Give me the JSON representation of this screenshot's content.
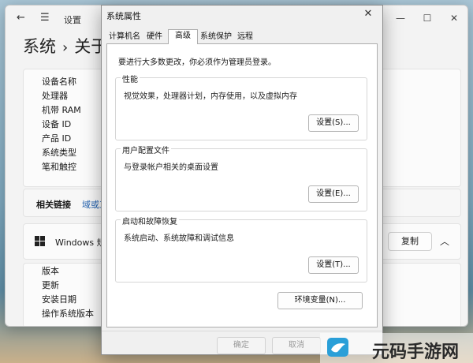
{
  "settings": {
    "title": "设置",
    "breadcrumb": {
      "parent": "系统",
      "current": "关于"
    },
    "device_spec_labels": [
      "设备名称",
      "处理器",
      "机带 RAM",
      "设备 ID",
      "产品 ID",
      "系统类型",
      "笔和触控"
    ],
    "related": {
      "title": "相关链接",
      "link": "域或工"
    },
    "windows_spec": {
      "title": "Windows 规",
      "copy_label": "复制"
    },
    "windows_spec_labels": [
      "版本",
      "更新",
      "安装日期",
      "操作系统版本"
    ]
  },
  "dialog": {
    "title": "系统属性",
    "tabs": [
      {
        "label": "计算机名"
      },
      {
        "label": "硬件"
      },
      {
        "label": "高级",
        "active": true
      },
      {
        "label": "系统保护"
      },
      {
        "label": "远程"
      }
    ],
    "admin_note": "要进行大多数更改，你必须作为管理员登录。",
    "performance": {
      "title": "性能",
      "desc": "视觉效果，处理器计划，内存使用，以及虚拟内存",
      "button": "设置(S)..."
    },
    "user_profiles": {
      "title": "用户配置文件",
      "desc": "与登录帐户相关的桌面设置",
      "button": "设置(E)..."
    },
    "startup_recovery": {
      "title": "启动和故障恢复",
      "desc": "系统启动、系统故障和调试信息",
      "button": "设置(T)..."
    },
    "env_button": "环境变量(N)...",
    "ok_button": "确定",
    "cancel_button": "取消"
  },
  "watermark": {
    "text": "元码手游网"
  }
}
